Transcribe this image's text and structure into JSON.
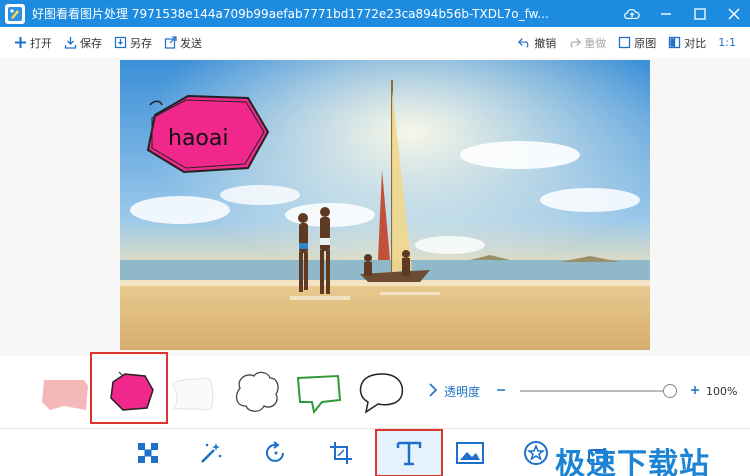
{
  "window": {
    "title": "好图看看图片处理 7971538e144a709b99aefab7771bd1772e23ca894b56b-TXDL7o_fw...",
    "buttons": [
      "cloud-upload-icon",
      "minimize-icon",
      "maximize-icon",
      "close-icon"
    ]
  },
  "toolbar": {
    "open": "打开",
    "save": "保存",
    "save_as": "另存",
    "send": "发送",
    "undo": "撤销",
    "redo": "重做",
    "original": "原图",
    "compare": "对比",
    "one_to_one": "1:1"
  },
  "canvas": {
    "bubble_text": "haoai",
    "bubble_color": "#f0288c"
  },
  "bubble_styles": [
    {
      "name": "pink-flag",
      "selected": false
    },
    {
      "name": "magenta-pentagon",
      "selected": true
    },
    {
      "name": "white-cloud-ribbon",
      "selected": false
    },
    {
      "name": "white-cloud",
      "selected": false
    },
    {
      "name": "green-outline-speech",
      "selected": false
    },
    {
      "name": "black-outline-speech",
      "selected": false
    }
  ],
  "opacity": {
    "label": "透明度",
    "value_text": "100%",
    "value": 1.0
  },
  "bottom_tools": [
    {
      "icon": "mosaic-icon",
      "active": false
    },
    {
      "icon": "magic-wand-icon",
      "active": false
    },
    {
      "icon": "rotate-icon",
      "active": false
    },
    {
      "icon": "crop-icon",
      "active": false
    },
    {
      "icon": "text-icon",
      "active": true
    },
    {
      "icon": "frame-icon",
      "active": false
    },
    {
      "icon": "sticker-icon",
      "active": false
    },
    {
      "icon": "more-icon",
      "active": false
    }
  ],
  "watermark": "极速下载站",
  "colors": {
    "accent": "#1d8ce0",
    "selection": "#d9362f"
  }
}
